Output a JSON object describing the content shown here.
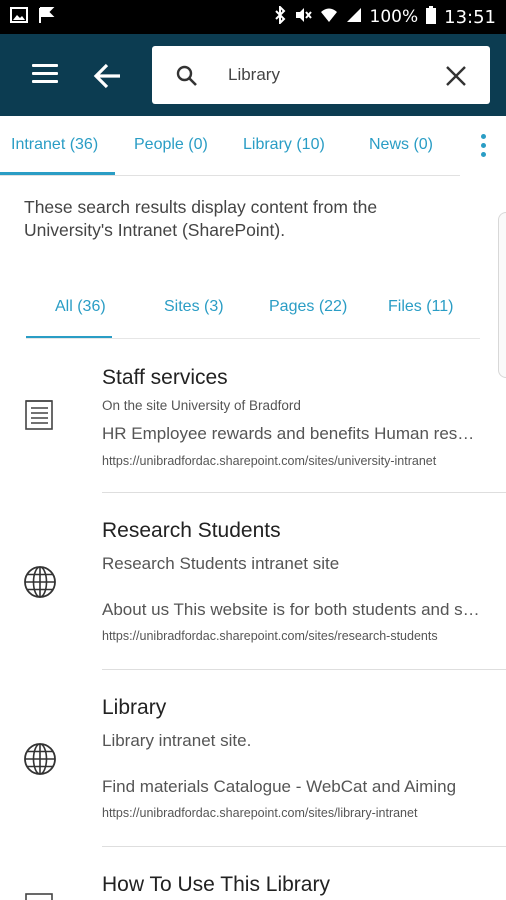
{
  "status_bar": {
    "left_icons": [
      "image-icon",
      "flag-icon"
    ],
    "right_icons": [
      "bluetooth-icon",
      "mute-icon",
      "wifi-icon",
      "signal-icon"
    ],
    "battery": "100%",
    "time": "13:51"
  },
  "app_bar": {
    "search_query": "Library"
  },
  "tabs": [
    {
      "label": "Intranet (36)",
      "active": true
    },
    {
      "label": "People (0)",
      "active": false
    },
    {
      "label": "Library (10)",
      "active": false
    },
    {
      "label": "News (0)",
      "active": false
    }
  ],
  "description": "These search results display content from the University's Intranet (SharePoint).",
  "sub_tabs": [
    {
      "label": "All (36)",
      "active": true
    },
    {
      "label": "Sites (3)",
      "active": false
    },
    {
      "label": "Pages (22)",
      "active": false
    },
    {
      "label": "Files (11)",
      "active": false
    }
  ],
  "results": [
    {
      "icon": "document-icon",
      "title": "Staff services",
      "subtitle": "On the site University of Bradford",
      "snippet": "HR Employee rewards and benefits Human resources",
      "url": "https://unibradfordac.sharepoint.com/sites/university-intranet"
    },
    {
      "icon": "globe-icon",
      "title": "Research Students",
      "subtitle": "Research Students intranet site",
      "snippet": "About us This website is for both students and staff",
      "url": "https://unibradfordac.sharepoint.com/sites/research-students"
    },
    {
      "icon": "globe-icon",
      "title": "Library",
      "subtitle": "Library intranet site.",
      "snippet": "Find materials Catalogue - WebCat and Aiming",
      "url": "https://unibradfordac.sharepoint.com/sites/library-intranet"
    },
    {
      "icon": "document-icon",
      "title": "How To Use This Library"
    }
  ],
  "colors": {
    "app_bar": "#0c3c51",
    "accent": "#2a9dc5"
  }
}
